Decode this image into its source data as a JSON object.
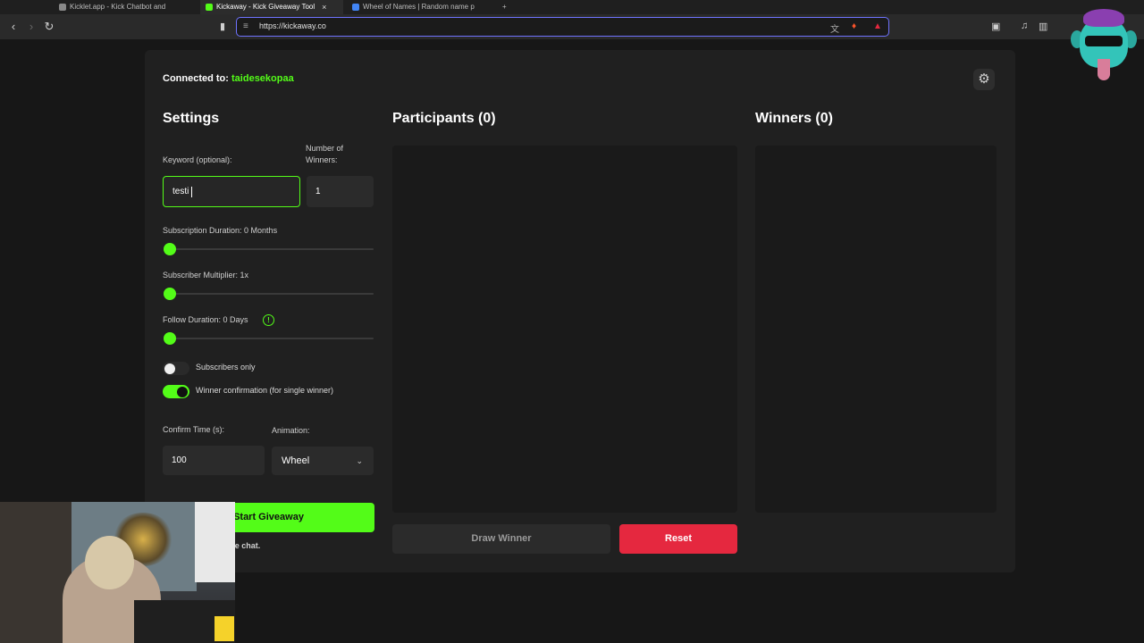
{
  "browser": {
    "tabs": [
      {
        "label": "Kicklet.app - Kick Chatbot and",
        "active": false
      },
      {
        "label": "Kickaway - Kick Giveaway Tool",
        "active": true
      },
      {
        "label": "Wheel of Names | Random name p",
        "active": false
      }
    ],
    "new_tab": "+",
    "close_glyph": "×",
    "url": "https://kickaway.co"
  },
  "app": {
    "connected_label": "Connected to:",
    "connected_user": "taidesekopaa",
    "settings_title": "Settings",
    "participants_title": "Participants (0)",
    "winners_title": "Winners (0)",
    "keyword_label": "Keyword (optional):",
    "keyword_value": "testi",
    "num_winners_label": "Number of Winners:",
    "num_winners_value": "1",
    "sub_duration_label": "Subscription Duration: 0 Months",
    "sub_duration_value": 0,
    "sub_multiplier_label": "Subscriber Multiplier: 1x",
    "sub_multiplier_value": 1,
    "follow_duration_label": "Follow Duration: 0 Days",
    "follow_duration_value": 0,
    "info_glyph": "!",
    "subscribers_only_label": "Subscribers only",
    "subscribers_only": false,
    "winner_confirmation_label": "Winner confirmation (for single winner)",
    "winner_confirmation": true,
    "confirm_time_label": "Confirm Time (s):",
    "confirm_time_value": "100",
    "animation_label": "Animation:",
    "animation_value": "Wheel",
    "start_button": "Start Giveaway",
    "hint_visible": "rt\" to connect to the chat.",
    "draw_button": "Draw Winner",
    "reset_button": "Reset"
  },
  "colors": {
    "accent": "#53fc18",
    "danger": "#e5283f",
    "panel": "#202020",
    "background": "#171717"
  },
  "icons": [
    "back-icon",
    "forward-icon",
    "reload-icon",
    "bookmark-icon",
    "site-info-icon",
    "translate-icon",
    "brave-shield-icon",
    "brave-rewards-icon",
    "gear-icon",
    "info-icon",
    "chevron-down-icon"
  ]
}
